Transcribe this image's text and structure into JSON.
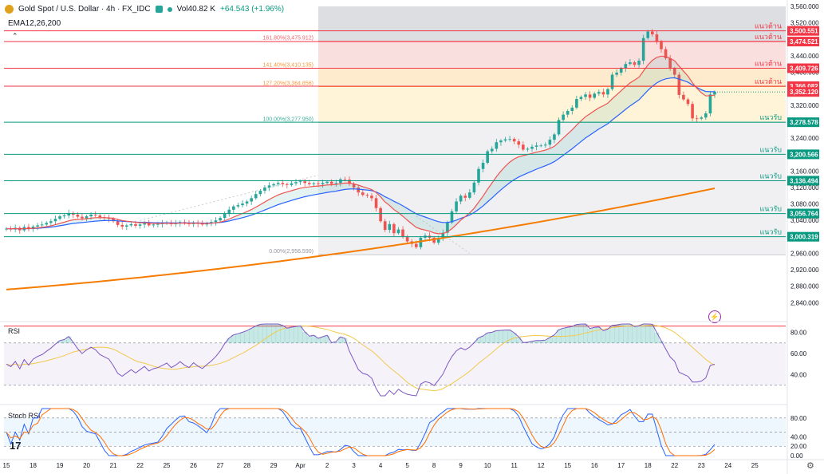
{
  "header": {
    "symbol": "Gold Spot / U.S. Dollar · 4h · FX_IDC",
    "volume": "Vol40.82 K",
    "change": "+64.543 (+1.96%)",
    "indicator": "EMA12,26,200"
  },
  "chart_data": [
    {
      "type": "candlestick",
      "symbol": "Gold Spot / U.S. Dollar · 4h · FX_IDC",
      "price_axis": {
        "ylim": [
          2800,
          3560
        ],
        "ticks": [
          "3,560.000",
          "3,520.000",
          "3,480.000",
          "3,440.000",
          "3,400.000",
          "3,360.000",
          "3,320.000",
          "3,280.000",
          "3,240.000",
          "3,200.000",
          "3,160.000",
          "3,120.000",
          "3,080.000",
          "3,040.000",
          "3,000.000",
          "2,960.000",
          "2,920.000",
          "2,880.000",
          "2,840.000"
        ],
        "tick_values": [
          3560,
          3520,
          3480,
          3440,
          3400,
          3360,
          3320,
          3280,
          3240,
          3200,
          3160,
          3120,
          3080,
          3040,
          3000,
          2960,
          2920,
          2880,
          2840
        ]
      },
      "time_axis": {
        "labels": [
          "15",
          "18",
          "19",
          "20",
          "21",
          "22",
          "25",
          "26",
          "27",
          "28",
          "29",
          "Apr",
          "2",
          "3",
          "4",
          "5",
          "8",
          "9",
          "10",
          "11",
          "12",
          "15",
          "16",
          "17",
          "18",
          "22",
          "23",
          "24",
          "25",
          "29"
        ],
        "label_index": [
          0,
          6,
          12,
          18,
          24,
          30,
          36,
          42,
          48,
          54,
          60,
          66,
          72,
          78,
          84,
          90,
          96,
          102,
          108,
          114,
          120,
          126,
          132,
          138,
          144,
          150,
          156,
          162,
          168,
          174
        ]
      },
      "closes": [
        3020,
        3018,
        3022,
        3016,
        3024,
        3019,
        3025,
        3028,
        3030,
        3034,
        3038,
        3044,
        3050,
        3052,
        3058,
        3054,
        3049,
        3045,
        3050,
        3054,
        3052,
        3048,
        3046,
        3044,
        3038,
        3029,
        3025,
        3028,
        3031,
        3027,
        3030,
        3033,
        3028,
        3030,
        3031,
        3033,
        3035,
        3031,
        3033,
        3036,
        3033,
        3031,
        3035,
        3032,
        3030,
        3033,
        3036,
        3040,
        3046,
        3056,
        3066,
        3074,
        3077,
        3081,
        3086,
        3094,
        3104,
        3112,
        3120,
        3125,
        3128,
        3131,
        3128,
        3126,
        3130,
        3133,
        3135,
        3131,
        3128,
        3130,
        3128,
        3131,
        3134,
        3129,
        3131,
        3140,
        3139,
        3129,
        3120,
        3108,
        3102,
        3100,
        3094,
        3070,
        3038,
        3017,
        3031,
        3009,
        3018,
        3001,
        2989,
        2983,
        2975,
        2998,
        3003,
        2998,
        2986,
        2997,
        3010,
        3035,
        3062,
        3086,
        3100,
        3095,
        3108,
        3132,
        3165,
        3180,
        3208,
        3214,
        3230,
        3234,
        3237,
        3238,
        3232,
        3224,
        3212,
        3214,
        3219,
        3222,
        3222,
        3224,
        3236,
        3249,
        3284,
        3297,
        3306,
        3314,
        3335,
        3340,
        3346,
        3338,
        3348,
        3352,
        3346,
        3359,
        3394,
        3399,
        3409,
        3420,
        3424,
        3418,
        3428,
        3483,
        3499,
        3492,
        3475,
        3456,
        3434,
        3409,
        3394,
        3345,
        3334,
        3323,
        3288,
        3287,
        3290,
        3300,
        3346,
        3352
      ],
      "annotations": [
        {
          "kind": "fibonacci",
          "label": "161.80%(3,475.912)",
          "value": 3475.912
        },
        {
          "kind": "fibonacci",
          "label": "141.40%(3,410.135)",
          "value": 3410.135
        },
        {
          "kind": "fibonacci",
          "label": "127.20%(3,364.856)",
          "value": 3364.856
        },
        {
          "kind": "fibonacci",
          "label": "100.00%(3,277.950)",
          "value": 3277.95
        },
        {
          "kind": "fibonacci",
          "label": "0.00%(2,956.590)",
          "value": 2956.59
        }
      ],
      "levels": [
        {
          "kind": "resistance",
          "label": "แนวต้าน",
          "price": "3,500.551",
          "value": 3500.551
        },
        {
          "kind": "resistance",
          "label": "แนวต้าน",
          "price": "3,474.521",
          "value": 3474.521
        },
        {
          "kind": "resistance",
          "label": "แนวต้าน",
          "price": "3,409.726",
          "value": 3409.726
        },
        {
          "kind": "resistance",
          "label": "แนวต้าน",
          "price": "3,366.082",
          "value": 3366.082
        },
        {
          "kind": "support",
          "label": "แนวรับ",
          "price": "3,278.578",
          "value": 3278.578
        },
        {
          "kind": "support",
          "label": "แนวรับ",
          "price": "3,200.566",
          "value": 3200.566
        },
        {
          "kind": "support",
          "label": "แนวรับ",
          "price": "3,136.494",
          "value": 3136.494
        },
        {
          "kind": "support",
          "label": "แนวรับ",
          "price": "3,056.764",
          "value": 3056.764
        },
        {
          "kind": "support",
          "label": "แนวรับ",
          "price": "3,000.319",
          "value": 3000.319
        }
      ],
      "last_price": {
        "label": "3,352.120",
        "value": 3352.12
      },
      "ema200_start": 2872,
      "ema200_end": 3118,
      "colors": {
        "up": "#26a69a",
        "down": "#ef5350",
        "ema12": "#ef5350",
        "ema26": "#2962ff",
        "ema200": "#f57c00",
        "resistance": "#f23645",
        "support": "#089981"
      }
    },
    {
      "type": "line",
      "name": "RSI",
      "ylim": [
        20,
        88
      ],
      "ticks": [
        "80.00",
        "60.00",
        "40.00"
      ],
      "tick_values": [
        80,
        60,
        40
      ],
      "upper_band": 70,
      "lower_band": 30
    },
    {
      "type": "line",
      "name": "Stoch RSI",
      "ylim": [
        -5,
        100
      ],
      "ticks": [
        "80.00",
        "40.00",
        "20.00",
        "0.00"
      ],
      "tick_values": [
        80,
        40,
        20,
        0
      ],
      "upper_band": 80,
      "lower_band": 20
    }
  ],
  "ui": {
    "tv_logo": "17",
    "gear_icon": "gear-icon",
    "alert_icon": "lightning-icon"
  }
}
